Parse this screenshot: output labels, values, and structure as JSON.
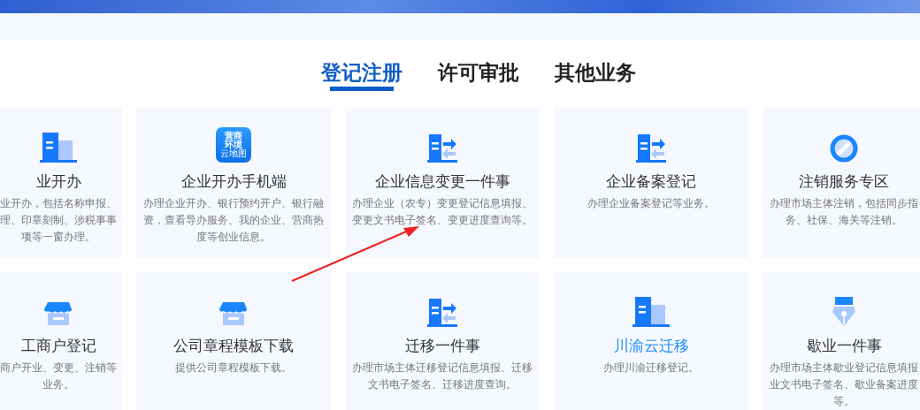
{
  "tabs": [
    {
      "label": "登记注册",
      "selected": true
    },
    {
      "label": "许可审批",
      "selected": false
    },
    {
      "label": "其他业务",
      "selected": false
    }
  ],
  "cards": [
    {
      "kind": "building",
      "title": "业开办",
      "description": "业开办，包括名称申报、理、印章刻制、涉税事事项等一窗办理。",
      "highlighted": false
    },
    {
      "kind": "app",
      "icon_text": [
        "营商",
        "环境",
        "云地图"
      ],
      "title": "企业开办手机端",
      "description": "办理企业开办、银行预约开户、银行融资，查看导办服务、我的企业、营商热度等创业信息。",
      "highlighted": false
    },
    {
      "kind": "transfer",
      "title": "企业信息变更一件事",
      "description": "办理企业（农专）变更登记信息填报、变更文书电子签名、变更进度查询等。",
      "highlighted": false
    },
    {
      "kind": "transfer",
      "title": "企业备案登记",
      "description": "办理企业备案登记等业务。",
      "highlighted": false
    },
    {
      "kind": "cancel",
      "title": "注销服务专区",
      "description": "办理市场主体注销，包括同步指务、社保、海关等注销。",
      "highlighted": false
    },
    {
      "kind": "shop",
      "title": "工商户登记",
      "description": "商户开业、变更、注销等业务。",
      "highlighted": false
    },
    {
      "kind": "shop",
      "title": "公司章程模板下载",
      "description": "提供公司章程模板下载。",
      "highlighted": false
    },
    {
      "kind": "transfer",
      "title": "迁移一件事",
      "description": "办理市场主体迁移登记信息填报、迁移文书电子签名、迁移进度查询。",
      "highlighted": false
    },
    {
      "kind": "building",
      "title": "川渝云迁移",
      "description": "办理川渝迁移登记。",
      "highlighted": true
    },
    {
      "kind": "pen",
      "title": "歇业一件事",
      "description": "办理市场主体歇业登记信息填报业文书电子签名、歇业备案进度等。",
      "highlighted": false
    }
  ]
}
